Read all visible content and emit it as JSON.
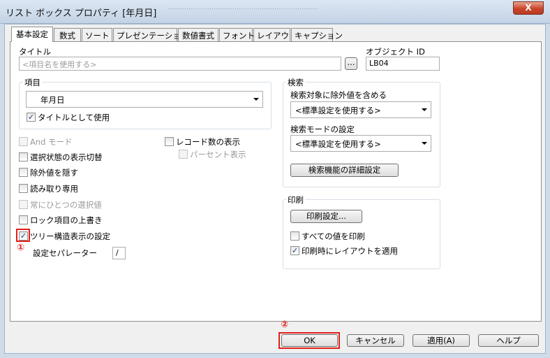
{
  "window": {
    "title": "リスト ボックス プロパティ [年月日]",
    "background_blur_text": "………………………………………………………………",
    "close_symbol": "X"
  },
  "tabs": [
    {
      "label": "基本設定",
      "active": true
    },
    {
      "label": "数式"
    },
    {
      "label": "ソート"
    },
    {
      "label": "プレゼンテーション"
    },
    {
      "label": "数値書式"
    },
    {
      "label": "フォント"
    },
    {
      "label": "レイアウト"
    },
    {
      "label": "キャプション"
    }
  ],
  "title_field": {
    "label": "タイトル",
    "placeholder": "<項目名を使用する>",
    "browse_label": "..."
  },
  "object_id": {
    "label": "オブジェクト ID",
    "value": "LB04"
  },
  "field_group": {
    "title": "項目",
    "selected": "年月日",
    "show_as_title": {
      "label": "タイトルとして使用",
      "checked": true
    }
  },
  "options": {
    "and_mode": {
      "label": "And モード",
      "checked": false,
      "disabled": true
    },
    "toggle_select": {
      "label": "選択状態の表示切替",
      "checked": false
    },
    "hide_excluded": {
      "label": "除外値を隠す",
      "checked": false
    },
    "read_only": {
      "label": "読み取り専用",
      "checked": false
    },
    "always_one": {
      "label": "常にひとつの選択値",
      "checked": false,
      "disabled": true
    },
    "lock_override": {
      "label": "ロック項目の上書き",
      "checked": false
    },
    "tree_view": {
      "label": "ツリー構造表示の設定",
      "checked": true
    },
    "separator_label": "設定セパレーター",
    "separator_value": "/",
    "show_frequency": {
      "label": "レコード数の表示",
      "checked": false
    },
    "percent": {
      "label": "パーセント表示",
      "checked": false,
      "disabled": true
    }
  },
  "search_group": {
    "title": "検索",
    "include_excluded_label": "検索対象に除外値を含める",
    "include_excluded_value": "<標準設定を使用する>",
    "mode_label": "検索モードの設定",
    "mode_value": "<標準設定を使用する>",
    "advanced_button": "検索機能の詳細設定"
  },
  "print_group": {
    "title": "印刷",
    "settings_button": "印刷設定...",
    "print_all": {
      "label": "すべての値を印刷",
      "checked": false
    },
    "layout_on_print": {
      "label": "印刷時にレイアウトを適用",
      "checked": true
    }
  },
  "annotations": {
    "one": "①",
    "two": "②"
  },
  "footer": {
    "ok": "OK",
    "cancel": "キャンセル",
    "apply": "適用(A)",
    "help": "ヘルプ"
  },
  "colors": {
    "annotation_red": "#e0201a",
    "accent_blue": "#3a6ea5"
  }
}
